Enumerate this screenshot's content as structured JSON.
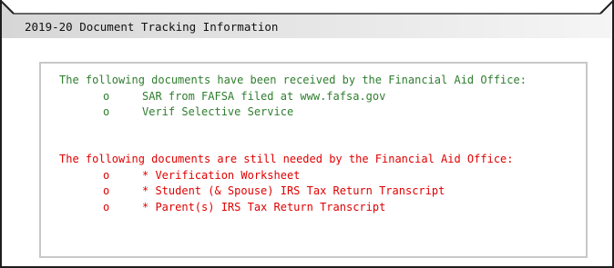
{
  "header": {
    "title": "2019-20 Document Tracking Information"
  },
  "received": {
    "intro": "The following documents have been received by the Financial Aid Office:",
    "bullet": "o",
    "items": [
      "SAR from FAFSA filed at www.fafsa.gov",
      "Verif Selective Service"
    ]
  },
  "needed": {
    "intro": "The following documents are still needed by the Financial Aid Office:",
    "bullet": "o",
    "items": [
      "* Verification Worksheet",
      "* Student (& Spouse) IRS Tax Return Transcript",
      "* Parent(s) IRS Tax Return Transcript"
    ]
  },
  "colors": {
    "received_text": "#2e7d2e",
    "needed_text": "#e00000",
    "header_gradient_start": "#d9d9d9",
    "header_gradient_end": "#f4f4f4",
    "frame": "#1e1e1e",
    "box_border": "#c8c8c8"
  }
}
